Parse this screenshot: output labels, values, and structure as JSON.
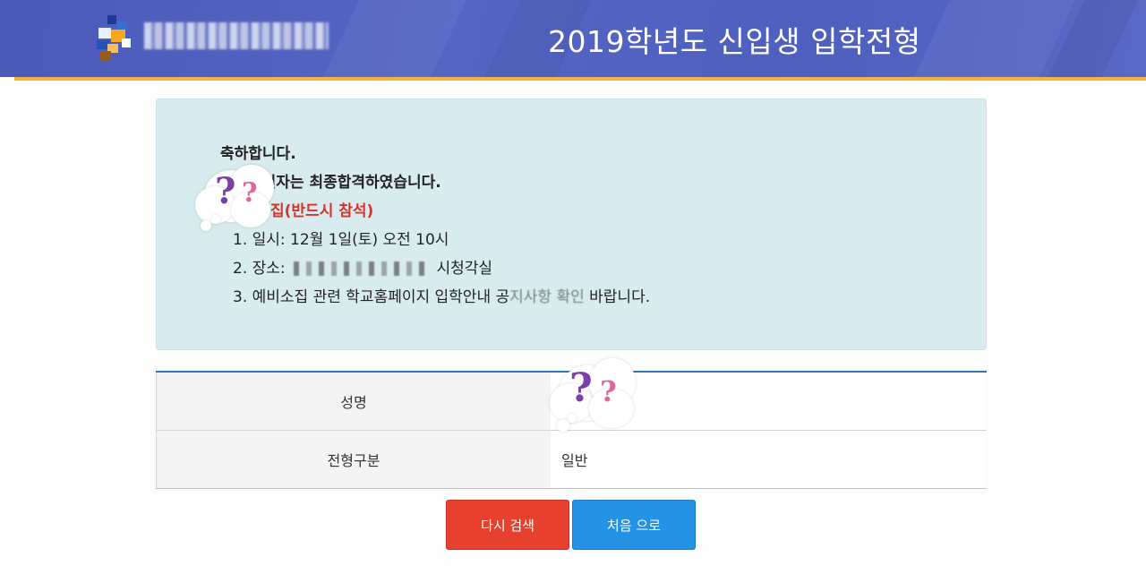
{
  "header": {
    "title": "2019학년도 신입생 입학전형",
    "logo_icon": "school-logo-icon",
    "colors": {
      "background": "#4f5fbe",
      "underline": "#f2b43a"
    }
  },
  "notice": {
    "congrats": "축하합니다.",
    "result": "지원자는 최종합격하였습니다.",
    "gathering_title": "집(반드시 참석)",
    "items": [
      {
        "number": "1.",
        "text": "일시: 12월 1일(토) 오전 10시"
      },
      {
        "number": "2.",
        "prefix": "장소:",
        "suffix": "시청각실"
      },
      {
        "number": "3.",
        "text": "예비소집 관련 학교홈페이지 입학안내 공",
        "text_tail": "지사항 확인",
        "text_end": "바랍니다."
      }
    ],
    "colors": {
      "background": "#d8ecef",
      "highlight": "#d9322b"
    }
  },
  "table": {
    "rows": [
      {
        "label": "성명",
        "value": ""
      },
      {
        "label": "전형구분",
        "value": "일반"
      }
    ],
    "colors": {
      "border_top": "#2e73b8",
      "header_bg": "#f4f4f4"
    }
  },
  "buttons": {
    "search_again": "다시 검색",
    "go_home": "처음 으로",
    "colors": {
      "search_again": "#e8402e",
      "go_home": "#2592e4"
    }
  }
}
